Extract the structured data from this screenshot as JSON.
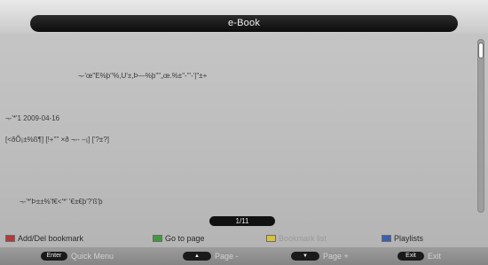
{
  "header": {
    "title": "e-Book"
  },
  "content": {
    "lines": [
      "¬-'œ\"E%þ''%,U'±,Þ—%þ'\"'„œ.%±\"-'\"-'|\"±+",
      "¬-'*'1 2009-04-16",
      "[<ðÕ¡±%ß¶] [!+'\"' ×ð ¬-- –¡] ['?±?]",
      "¬-'*'Þ±±%'f€<'*' '€±€þ'?'ß'þ"
    ]
  },
  "pager": {
    "indicator": "1/11"
  },
  "legend": {
    "items": [
      {
        "label": "Add/Del bookmark",
        "color": "#b23a3a",
        "dim": false
      },
      {
        "label": "Go to page",
        "color": "#3f9a3f",
        "dim": false
      },
      {
        "label": "Bookmark list",
        "color": "#d8c23a",
        "dim": true
      },
      {
        "label": "Playlists",
        "color": "#3a5fb2",
        "dim": false
      }
    ]
  },
  "footer": {
    "hints": [
      {
        "key": "Enter",
        "label": "Quick Menu"
      },
      {
        "key": "▲",
        "label": "Page -"
      },
      {
        "key": "▼",
        "label": "Page +"
      },
      {
        "key": "Exit",
        "label": "Exit"
      }
    ]
  }
}
